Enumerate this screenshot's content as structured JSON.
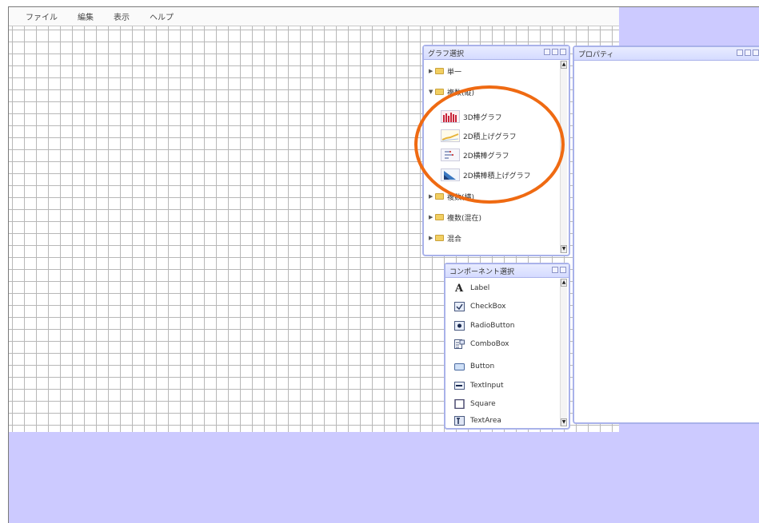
{
  "menu": [
    "ファイル",
    "編集",
    "表示",
    "ヘルプ"
  ],
  "graph_panel": {
    "title": "グラフ選択",
    "categories": [
      {
        "label": "単一",
        "expanded": false
      },
      {
        "label": "複数(縦)",
        "expanded": true
      }
    ],
    "sub_items": [
      {
        "label": "3D棒グラフ",
        "icon": "3d-bar-chart-icon"
      },
      {
        "label": "2D積上げグラフ",
        "icon": "2d-stacked-chart-icon"
      },
      {
        "label": "2D横棒グラフ",
        "icon": "2d-horizontal-bar-chart-icon"
      },
      {
        "label": "2D横棒積上げグラフ",
        "icon": "2d-horizontal-stacked-chart-icon"
      }
    ],
    "after_categories": [
      {
        "label": "複数(横)"
      },
      {
        "label": "複数(混在)"
      },
      {
        "label": "混合"
      }
    ]
  },
  "component_panel": {
    "title": "コンポーネント選択",
    "items": [
      {
        "label": "Label",
        "icon": "label-a-icon"
      },
      {
        "label": "CheckBox",
        "icon": "checkbox-icon"
      },
      {
        "label": "RadioButton",
        "icon": "radio-button-icon"
      },
      {
        "label": "ComboBox",
        "icon": "combobox-icon"
      },
      {
        "label": "Button",
        "icon": "button-icon"
      },
      {
        "label": "TextInput",
        "icon": "text-input-icon"
      },
      {
        "label": "Square",
        "icon": "square-icon"
      },
      {
        "label": "TextArea",
        "icon": "text-area-icon"
      }
    ]
  },
  "properties_panel": {
    "title": "プロパティ"
  },
  "colors": {
    "background": "#cccaff",
    "panel_border": "#a9b2ea",
    "highlight": "#ef6a12"
  }
}
